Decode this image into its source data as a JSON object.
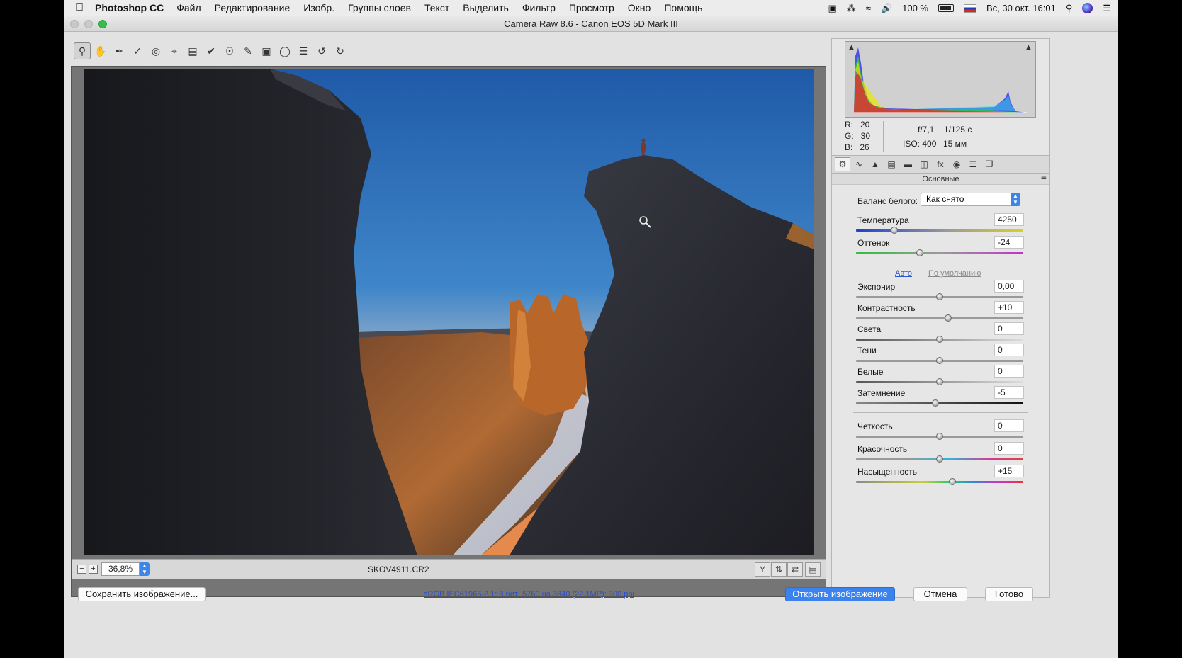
{
  "menubar": {
    "app": "Photoshop CC",
    "items": [
      "Файл",
      "Редактирование",
      "Изобр.",
      "Группы слоев",
      "Текст",
      "Выделить",
      "Фильтр",
      "Просмотр",
      "Окно",
      "Помощь"
    ],
    "battery": "100 %",
    "clock": "Вс, 30 окт.  16:01"
  },
  "window": {
    "title": "Camera Raw 8.6  -  Canon EOS 5D Mark III"
  },
  "toolbar": {
    "tools": [
      "zoom-tool-icon",
      "hand-tool-icon",
      "white-balance-tool-icon",
      "color-sampler-tool-icon",
      "targeted-adjustment-tool-icon",
      "crop-tool-icon",
      "straighten-tool-icon",
      "spot-removal-tool-icon",
      "red-eye-tool-icon",
      "adjustment-brush-icon",
      "graduated-filter-icon",
      "radial-filter-icon",
      "preferences-icon",
      "rotate-left-icon",
      "rotate-right-icon"
    ],
    "active_tool": "zoom-tool-icon"
  },
  "preview": {
    "zoom": "36,8%",
    "filename": "SKOV4911.CR2"
  },
  "readout": {
    "r_label": "R:",
    "r": "20",
    "g_label": "G:",
    "g": "30",
    "b_label": "B:",
    "b": "26",
    "aperture": "f/7,1",
    "shutter": "1/125 с",
    "iso": "ISO: 400",
    "focal": "15 мм"
  },
  "panel": {
    "section_title": "Основные",
    "white_balance_label": "Баланс белого:",
    "white_balance_value": "Как снято",
    "auto_link": "Авто",
    "default_link": "По умолчанию",
    "sliders": [
      {
        "label": "Температура",
        "value": "4250",
        "level": 0.23,
        "style": "temp"
      },
      {
        "label": "Оттенок",
        "value": "-24",
        "level": 0.38,
        "style": "tint"
      },
      {
        "label": "Экспонир",
        "value": "0,00",
        "level": 0.5,
        "style": "plain"
      },
      {
        "label": "Контрастность",
        "value": "+10",
        "level": 0.55,
        "style": "plain"
      },
      {
        "label": "Света",
        "value": "0",
        "level": 0.5,
        "style": "hl"
      },
      {
        "label": "Тени",
        "value": "0",
        "level": 0.5,
        "style": "plain"
      },
      {
        "label": "Белые",
        "value": "0",
        "level": 0.5,
        "style": "hl"
      },
      {
        "label": "Затемнение",
        "value": "-5",
        "level": 0.475,
        "style": "dark"
      },
      {
        "label": "Четкость",
        "value": "0",
        "level": 0.5,
        "style": "plain"
      },
      {
        "label": "Красочность",
        "value": "0",
        "level": 0.5,
        "style": "vib"
      },
      {
        "label": "Насыщенность",
        "value": "+15",
        "level": 0.575,
        "style": "sat"
      }
    ]
  },
  "footer": {
    "save": "Сохранить изображение...",
    "workflow": "sRGB IEC61966-2.1; 8 бит; 5760 на 3840 (22,1MP); 300 ppi",
    "open": "Открыть изображение",
    "cancel": "Отмена",
    "done": "Готово"
  },
  "colors": {
    "accent": "#3b82ec",
    "link": "#2a4ed0"
  }
}
